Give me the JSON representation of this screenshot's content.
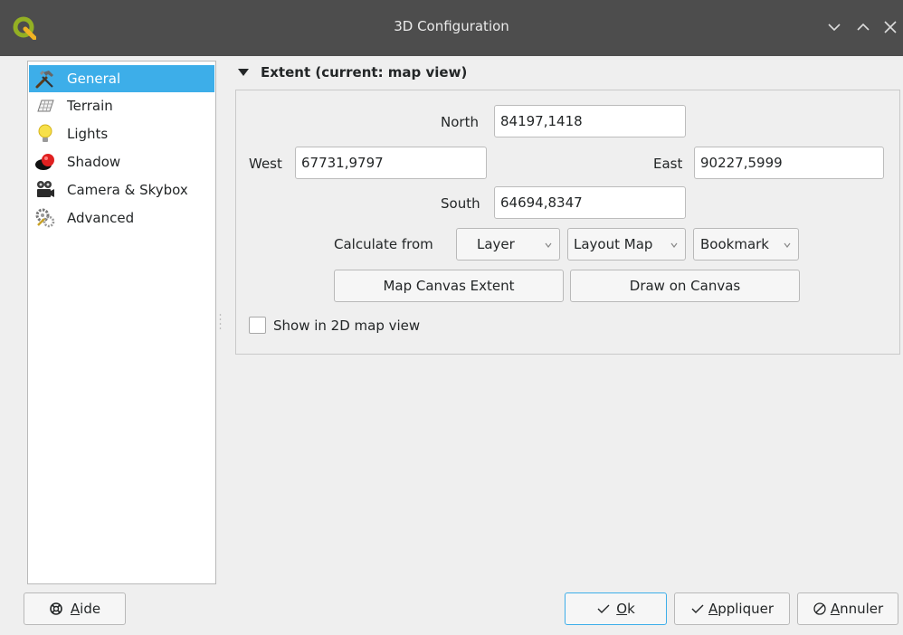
{
  "window": {
    "title": "3D Configuration"
  },
  "sidebar": {
    "items": [
      {
        "label": "General",
        "icon": "hammer-icon",
        "selected": true
      },
      {
        "label": "Terrain",
        "icon": "terrain-grid-icon"
      },
      {
        "label": "Lights",
        "icon": "lightbulb-icon"
      },
      {
        "label": "Shadow",
        "icon": "shadow-sphere-icon"
      },
      {
        "label": "Camera & Skybox",
        "icon": "camera-icon"
      },
      {
        "label": "Advanced",
        "icon": "gears-icon"
      }
    ]
  },
  "extent": {
    "header": "Extent (current: map view)",
    "north_label": "North",
    "north_value": "84197,1418",
    "west_label": "West",
    "west_value": "67731,9797",
    "east_label": "East",
    "east_value": "90227,5999",
    "south_label": "South",
    "south_value": "64694,8347",
    "calculate_from_label": "Calculate from",
    "layer_combo": "Layer",
    "layout_map_combo": "Layout Map",
    "bookmark_combo": "Bookmark",
    "map_canvas_extent_button": "Map Canvas Extent",
    "draw_on_canvas_button": "Draw on Canvas",
    "show_2d_checkbox_label": "Show in 2D map view",
    "show_2d_checked": false
  },
  "footer": {
    "help_button": {
      "underline": "A",
      "rest": "ide"
    },
    "ok_button": {
      "underline": "O",
      "rest": "k"
    },
    "apply_button": {
      "underline": "A",
      "rest": "ppliquer"
    },
    "cancel_button": {
      "underline": "A",
      "rest": "nnuler"
    }
  },
  "colors": {
    "accent": "#3daee9",
    "titlebar": "#4d4d4d",
    "qgis_green": "#93b023"
  }
}
